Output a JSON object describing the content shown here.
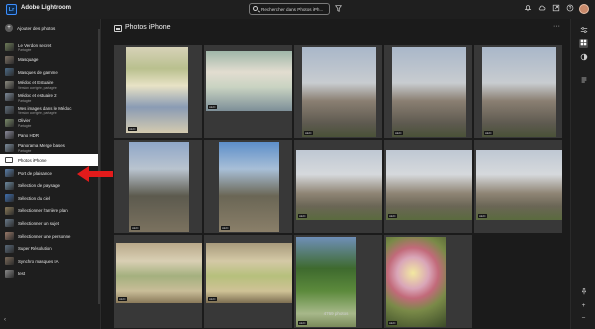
{
  "app": {
    "logo": "Lr",
    "title": "Adobe Lightroom"
  },
  "search": {
    "placeholder": "Rechercher dans Photos iPh..."
  },
  "top_icons": [
    "bell-icon",
    "cloud-icon",
    "share-icon",
    "help-icon",
    "avatar"
  ],
  "sidebar": {
    "add_label": "Ajouter des photos",
    "items": [
      {
        "label": "Le Verdon secret",
        "sub": "Partagée",
        "thumb": "#6d7b58"
      },
      {
        "label": "Masquage",
        "sub": "",
        "thumb": "#7c7064"
      },
      {
        "label": "Masques de gamme",
        "sub": "",
        "thumb": "#4d6b86"
      },
      {
        "label": "Médoc et Estuaire",
        "sub": "Version corrigée, partagée",
        "thumb": "#8b8a80"
      },
      {
        "label": "Médoc et estuaire 2",
        "sub": "Partagée",
        "thumb": "#7e8b9a"
      },
      {
        "label": "Mes images dans le Médoc",
        "sub": "Version corrigée, partagée",
        "thumb": "#5f6d7a"
      },
      {
        "label": "Olivier",
        "sub": "Partagée",
        "thumb": "#7a8a6a"
      },
      {
        "label": "Pano HDR",
        "sub": "",
        "thumb": "#8a8a9a"
      },
      {
        "label": "Panorama Merge bases",
        "sub": "Partagée",
        "thumb": "#7d8d9d"
      },
      {
        "label": "Photos iPhone",
        "sub": "",
        "thumb": "",
        "selected": true
      },
      {
        "label": "Port de plaisance",
        "sub": "",
        "thumb": "#5a7ea8"
      },
      {
        "label": "Sélection de paysage",
        "sub": "",
        "thumb": "#6e8aa0"
      },
      {
        "label": "Sélection du ciel",
        "sub": "",
        "thumb": "#3f6fae"
      },
      {
        "label": "Sélectionner l'arrière plan",
        "sub": "",
        "thumb": "#8a7a5a"
      },
      {
        "label": "Sélectionner un sujet",
        "sub": "",
        "thumb": "#6a7a8a"
      },
      {
        "label": "Sélectionner une personne",
        "sub": "",
        "thumb": "#9a7a6a"
      },
      {
        "label": "Super Résolution",
        "sub": "",
        "thumb": "#5a6a7a"
      },
      {
        "label": "Synchro masques IA",
        "sub": "",
        "thumb": "#7a6a5a"
      },
      {
        "label": "test",
        "sub": "",
        "thumb": "#8a8a8a"
      }
    ]
  },
  "main": {
    "title": "Photos iPhone",
    "photo_count": "4769 photos",
    "badge": "HEIC"
  },
  "colors": {
    "accent_arrow": "#e31b1b",
    "selected_bg": "#ffffff"
  }
}
